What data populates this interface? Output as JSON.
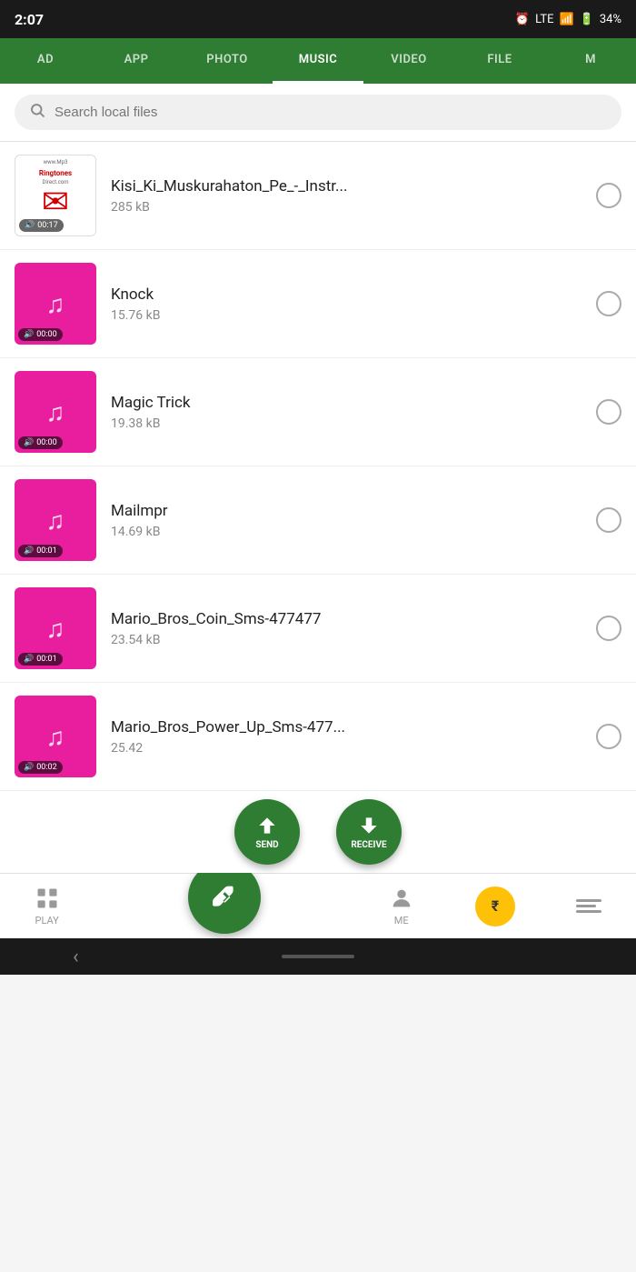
{
  "statusBar": {
    "time": "2:07",
    "batteryLevel": "34%",
    "signal": "LTE"
  },
  "navTabs": {
    "items": [
      {
        "label": "AD",
        "active": false
      },
      {
        "label": "APP",
        "active": false
      },
      {
        "label": "PHOTO",
        "active": false
      },
      {
        "label": "MUSIC",
        "active": true
      },
      {
        "label": "VIDEO",
        "active": false
      },
      {
        "label": "FILE",
        "active": false
      },
      {
        "label": "M",
        "active": false
      }
    ]
  },
  "search": {
    "placeholder": "Search local files"
  },
  "files": [
    {
      "id": 1,
      "name": "Kisi_Ki_Muskurahaton_Pe_-_Instr...",
      "size": "285 kB",
      "thumb": "ringtones",
      "duration": "00:17"
    },
    {
      "id": 2,
      "name": "Knock",
      "size": "15.76 kB",
      "thumb": "pink",
      "duration": "00:00"
    },
    {
      "id": 3,
      "name": "Magic Trick",
      "size": "19.38 kB",
      "thumb": "pink",
      "duration": "00:00"
    },
    {
      "id": 4,
      "name": "Mailmpr",
      "size": "14.69 kB",
      "thumb": "pink",
      "duration": "00:01"
    },
    {
      "id": 5,
      "name": "Mario_Bros_Coin_Sms-477477",
      "size": "23.54 kB",
      "thumb": "pink",
      "duration": "00:01"
    },
    {
      "id": 6,
      "name": "Mario_Bros_Power_Up_Sms-477...",
      "size": "25.42",
      "thumb": "pink",
      "duration": "00:02"
    }
  ],
  "fab": {
    "send": "SEND",
    "receive": "RECEIVE"
  },
  "bottomNav": {
    "play": "PLAY",
    "me": "ME"
  }
}
